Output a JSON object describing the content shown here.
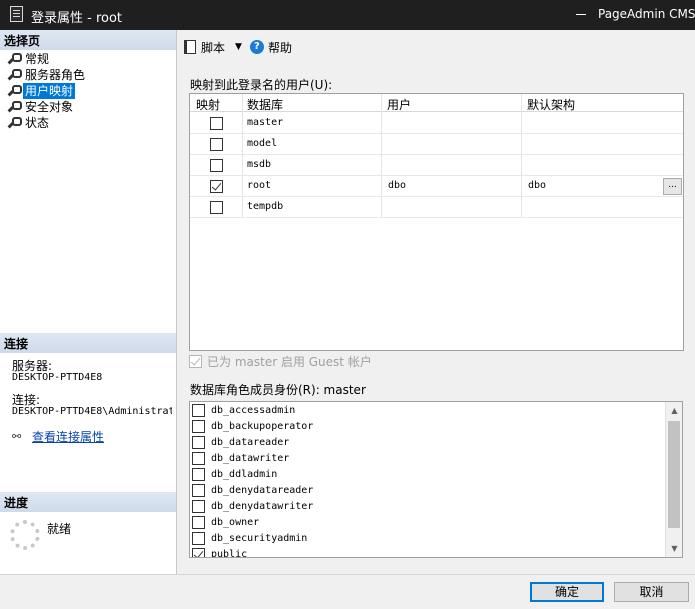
{
  "window": {
    "title": "登录属性 - root",
    "overlay_text": "PageAdmin CMS"
  },
  "left": {
    "select_page_header": "选择页",
    "pages": [
      {
        "label": "常规",
        "selected": false
      },
      {
        "label": "服务器角色",
        "selected": false
      },
      {
        "label": "用户映射",
        "selected": true
      },
      {
        "label": "安全对象",
        "selected": false
      },
      {
        "label": "状态",
        "selected": false
      }
    ],
    "connection_header": "连接",
    "server_label": "服务器:",
    "server_value": "DESKTOP-PTTD4E8",
    "connection_label": "连接:",
    "connection_value": "DESKTOP-PTTD4E8\\Administrat",
    "view_connection_link": "查看连接属性",
    "progress_header": "进度",
    "progress_status": "就绪"
  },
  "toolbar": {
    "script_label": "脚本",
    "help_label": "帮助"
  },
  "users_grid": {
    "label": "映射到此登录名的用户(U):",
    "columns": [
      "映射",
      "数据库",
      "用户",
      "默认架构"
    ],
    "rows": [
      {
        "mapped": false,
        "database": "master",
        "user": "",
        "schema": ""
      },
      {
        "mapped": false,
        "database": "model",
        "user": "",
        "schema": ""
      },
      {
        "mapped": false,
        "database": "msdb",
        "user": "",
        "schema": ""
      },
      {
        "mapped": true,
        "database": "root",
        "user": "dbo",
        "schema": "dbo"
      },
      {
        "mapped": false,
        "database": "tempdb",
        "user": "",
        "schema": ""
      }
    ],
    "ellipsis": "..."
  },
  "guest": {
    "label": "已为 master 启用 Guest 帐户",
    "checked": true,
    "disabled": true
  },
  "roles": {
    "label": "数据库角色成员身份(R): master",
    "items": [
      {
        "name": "db_accessadmin",
        "checked": false
      },
      {
        "name": "db_backupoperator",
        "checked": false
      },
      {
        "name": "db_datareader",
        "checked": false
      },
      {
        "name": "db_datawriter",
        "checked": false
      },
      {
        "name": "db_ddladmin",
        "checked": false
      },
      {
        "name": "db_denydatareader",
        "checked": false
      },
      {
        "name": "db_denydatawriter",
        "checked": false
      },
      {
        "name": "db_owner",
        "checked": false
      },
      {
        "name": "db_securityadmin",
        "checked": false
      },
      {
        "name": "public",
        "checked": true
      }
    ]
  },
  "buttons": {
    "ok": "确定",
    "cancel": "取消"
  },
  "colors": {
    "accent": "#0078d7",
    "title_bar": "#1f1f1f",
    "link": "#0645ad"
  }
}
